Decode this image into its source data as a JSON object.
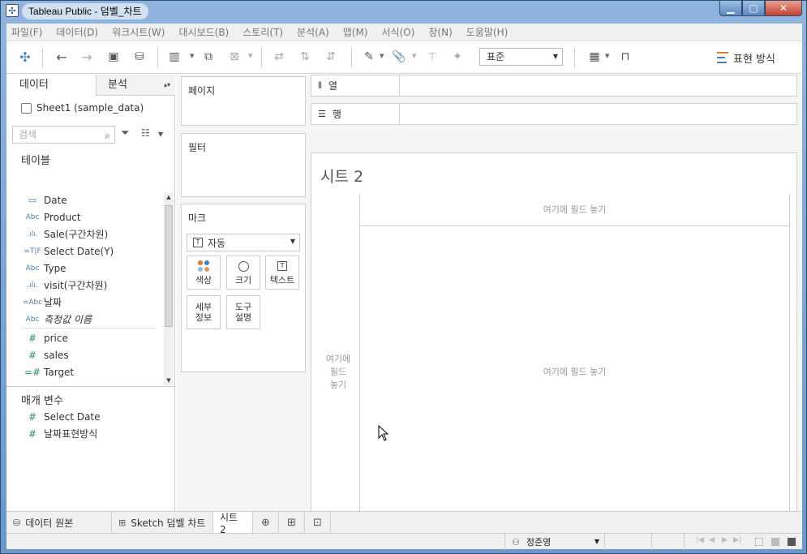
{
  "window": {
    "title": "Tableau Public - 덤벨_차트"
  },
  "menu": [
    "파일(F)",
    "데이터(D)",
    "워크시트(W)",
    "대시보드(B)",
    "스토리(T)",
    "분석(A)",
    "맵(M)",
    "서식(O)",
    "창(N)",
    "도움말(H)"
  ],
  "toolbar": {
    "fit_select": "표준",
    "show_me": "표현 방식"
  },
  "data_pane": {
    "tab_data": "데이터",
    "tab_analysis": "분석",
    "datasource": "Sheet1 (sample_data)",
    "search_placeholder": "검색",
    "tables_title": "테이블",
    "fields": [
      {
        "icon": "date",
        "name": "Date"
      },
      {
        "icon": "Abc",
        "name": "Product"
      },
      {
        "icon": "bin",
        "name": "Sale(구간차원)"
      },
      {
        "icon": "=T|F",
        "name": "Select Date(Y)"
      },
      {
        "icon": "Abc",
        "name": "Type"
      },
      {
        "icon": "bin",
        "name": "visit(구간차원)"
      },
      {
        "icon": "=Abc",
        "name": "날짜"
      },
      {
        "icon": "Abc",
        "name": "측정값 이름"
      },
      {
        "icon": "#",
        "name": "price"
      },
      {
        "icon": "#",
        "name": "sales"
      },
      {
        "icon": "=#",
        "name": "Target"
      }
    ],
    "params_title": "매개 변수",
    "params": [
      {
        "icon": "#",
        "name": "Select Date"
      },
      {
        "icon": "#",
        "name": "날짜표현방식"
      }
    ]
  },
  "cards": {
    "pages": "페이지",
    "filters": "필터",
    "marks": "마크",
    "mark_type": "자동",
    "mark_buttons": [
      "색상",
      "크기",
      "텍스트",
      "세부\n정보",
      "도구\n설명"
    ]
  },
  "shelves": {
    "columns": "열",
    "rows": "행"
  },
  "view": {
    "sheet_title": "시트 2",
    "drop_hint_cols": "여기에 필드 놓기",
    "drop_hint_center": "여기에 필드 놓기",
    "drop_hint_rows": "여기에\n필드\n놓기"
  },
  "tabs": {
    "data_source": "데이터 원본",
    "sheets": [
      "Sketch 덤벨 차트",
      "시트 2"
    ]
  },
  "status": {
    "user": "정준영"
  },
  "colors": {
    "accent_blue": "#4a7fb8",
    "mark_dots": [
      "#e07b26",
      "#4a7fb8",
      "#8fb9d8",
      "#d0a26a"
    ]
  }
}
